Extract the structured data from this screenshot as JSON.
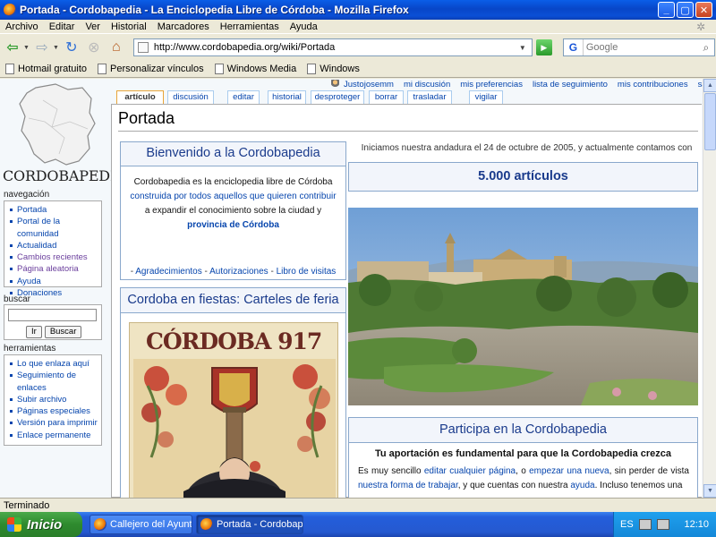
{
  "window": {
    "title": "Portada - Cordobapedia - La Enciclopedia Libre de Córdoba - Mozilla Firefox"
  },
  "menu": [
    "Archivo",
    "Editar",
    "Ver",
    "Historial",
    "Marcadores",
    "Herramientas",
    "Ayuda"
  ],
  "address": {
    "url": "http://www.cordobapedia.org/wiki/Portada"
  },
  "search_engine": {
    "placeholder": "Google",
    "icon": "G"
  },
  "bookmarks": [
    "Hotmail gratuito",
    "Personalizar vínculos",
    "Windows Media",
    "Windows"
  ],
  "user_links": [
    "Justojosemm",
    "mi discusión",
    "mis preferencias",
    "lista de seguimiento",
    "mis contribuciones",
    "salir"
  ],
  "tabs": [
    "artículo",
    "discusión",
    "editar",
    "historial",
    "desproteger",
    "borrar",
    "trasladar",
    "vigilar"
  ],
  "logo": {
    "wordmark": "CORDOBAPEDIA"
  },
  "sidebar": {
    "nav_heading": "navegación",
    "nav": [
      "Portada",
      "Portal de la comunidad",
      "Actualidad",
      "Cambios recientes",
      "Página aleatoria",
      "Ayuda",
      "Donaciones"
    ],
    "search_heading": "buscar",
    "search_go": "Ir",
    "search_button": "Buscar",
    "tools_heading": "herramientas",
    "tools": [
      "Lo que enlaza aquí",
      "Seguimiento de enlaces",
      "Subir archivo",
      "Páginas especiales",
      "Versión para imprimir",
      "Enlace permanente"
    ]
  },
  "page": {
    "title": "Portada",
    "welcome": {
      "heading": "Bienvenido a la Cordobapedia",
      "line1": "Cordobapedia es la enciclopedia libre de Córdoba",
      "line2a": "construida por ",
      "line2b": "todos aquellos que quieren contribuir",
      "line3": "a expandir el conocimiento sobre la ciudad y",
      "line4": "provincia de Córdoba",
      "footer": [
        "Agradecimientos",
        "Autorizaciones",
        "Libro de visitas"
      ],
      "footer_sep": " - "
    },
    "fiestas": {
      "heading": "Cordoba en fiestas: Carteles de feria",
      "poster_text": "CÓRDOBA 917"
    },
    "intro": "Iniciamos nuestra andadura el 24 de octubre de 2005, y actualmente contamos con",
    "count": "5.000 artículos",
    "participa": {
      "heading": "Participa en la Cordobapedia",
      "lead": "Tu aportación es fundamental para que la Cordobapedia crezca",
      "t1": "Es muy sencillo ",
      "l1": "editar cualquier página",
      "t2": ", o ",
      "l2": "empezar una nueva",
      "t3": ", sin perder de vista ",
      "l3": "nuestra forma de trabajar",
      "t4": ", y que cuentas con nuestra ",
      "l4": "ayuda",
      "t5": ". Incluso tenemos una"
    }
  },
  "status": "Terminado",
  "taskbar": {
    "start": "Inicio",
    "tasks": [
      "Callejero del Ayunta...",
      "Portada - Cordobape..."
    ],
    "lang": "ES",
    "clock": "12:10"
  },
  "colors": {
    "link": "#0645ad",
    "box_border": "#8aa8cc",
    "heading": "#1a3b8c"
  }
}
